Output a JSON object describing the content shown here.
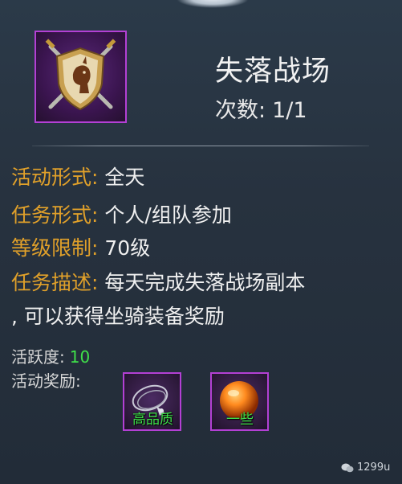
{
  "quest": {
    "title": "失落战场",
    "count_label": "次数:",
    "count_value": "1/1"
  },
  "details": [
    {
      "key": "活动形式:",
      "value": "全天"
    },
    {
      "key": "任务形式:",
      "value": "个人/组队参加"
    },
    {
      "key": "等级限制:",
      "value": "70级"
    },
    {
      "key": "任务描述:",
      "value": "每天完成失落战场副本"
    }
  ],
  "description_continued": ", 可以获得坐骑装备奖励",
  "activity": {
    "label": "活跃度:",
    "value": "10"
  },
  "rewards": {
    "label": "活动奖励:",
    "items": [
      {
        "icon": "necklace-icon",
        "tag": "高品质"
      },
      {
        "icon": "orange-orb-icon",
        "tag": "一些"
      }
    ]
  },
  "watermark": "1299u",
  "colors": {
    "key_text": "#e0a02a",
    "value_text": "#f0f0f0",
    "green": "#3fe04a",
    "frame_purple": "#b340d4",
    "background": "#27323f"
  }
}
